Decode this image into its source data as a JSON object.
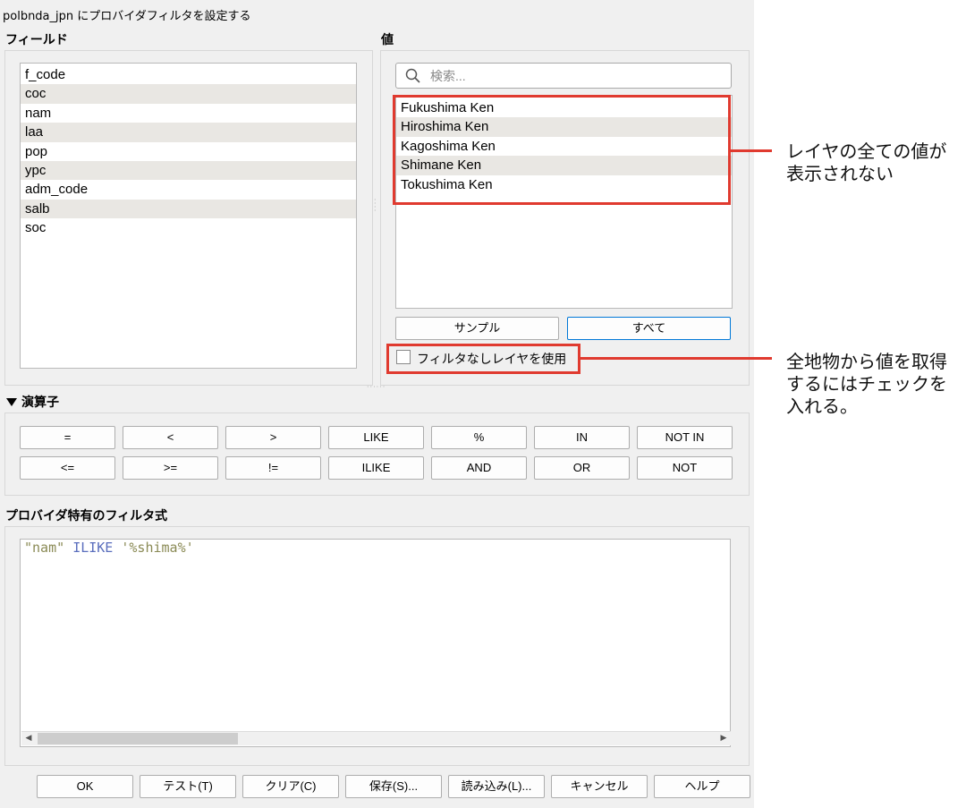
{
  "window": {
    "title": "polbnda_jpn にプロバイダフィルタを設定する"
  },
  "fields_section": {
    "label": "フィールド",
    "items": [
      "f_code",
      "coc",
      "nam",
      "laa",
      "pop",
      "ypc",
      "adm_code",
      "salb",
      "soc"
    ]
  },
  "values_section": {
    "label": "値",
    "search_placeholder": "検索...",
    "items": [
      "Fukushima Ken",
      "Hiroshima Ken",
      "Kagoshima Ken",
      "Shimane Ken",
      "Tokushima Ken"
    ],
    "sample_button": "サンプル",
    "all_button": "すべて",
    "use_unfiltered_label": "フィルタなしレイヤを使用"
  },
  "operators_section": {
    "label": "演算子",
    "row1": [
      "=",
      "<",
      ">",
      "LIKE",
      "%",
      "IN",
      "NOT IN"
    ],
    "row2": [
      "<=",
      ">=",
      "!=",
      "ILIKE",
      "AND",
      "OR",
      "NOT"
    ]
  },
  "expression_section": {
    "label": "プロバイダ特有のフィルタ式",
    "tokens": {
      "field": "\"nam\"",
      "keyword": "ILIKE",
      "string": "'%shima%'"
    }
  },
  "bottom_buttons": [
    "OK",
    "テスト(T)",
    "クリア(C)",
    "保存(S)...",
    "読み込み(L)...",
    "キャンセル",
    "ヘルプ"
  ],
  "annotations": {
    "values_note": [
      "レイヤの全ての値が",
      "表示されない"
    ],
    "checkbox_note": [
      "全地物から値を取得",
      "するにはチェックを",
      "入れる。"
    ]
  },
  "colors": {
    "highlight_red": "#e03a2f",
    "alt_row": "#e9e7e3",
    "primary_border": "#0078d7"
  }
}
